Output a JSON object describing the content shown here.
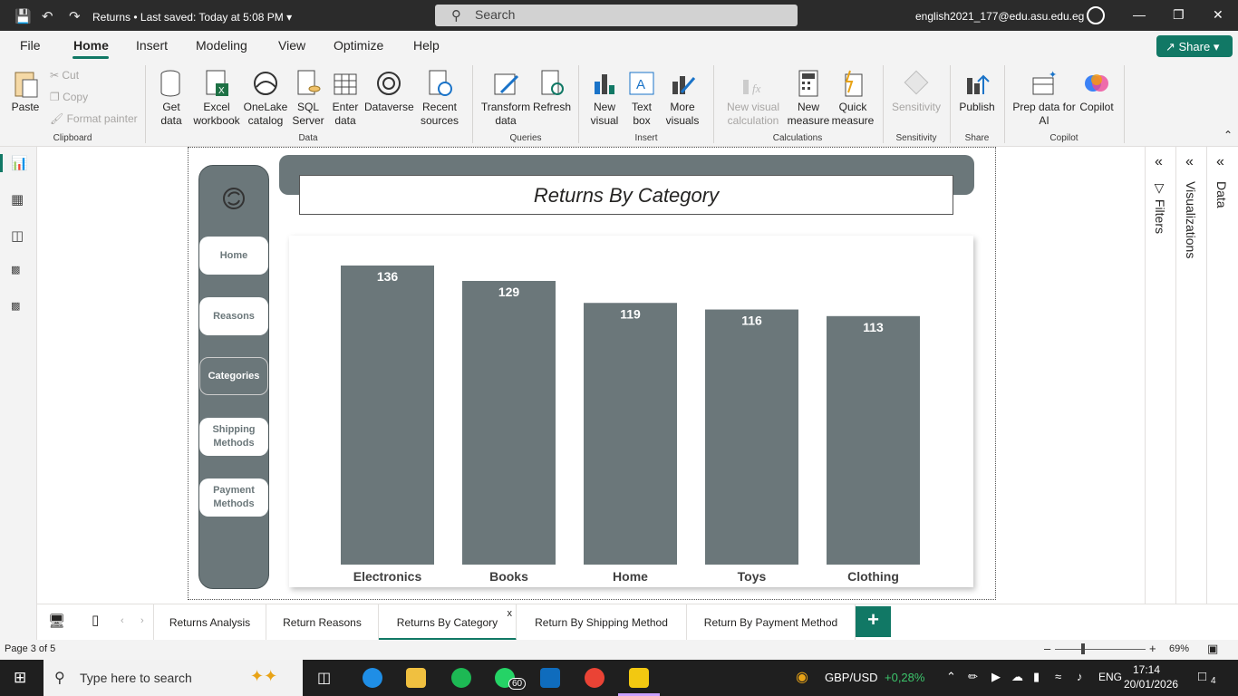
{
  "titlebar": {
    "doc_title": "Returns",
    "saved_status": "Last saved: Today at 5:08 PM",
    "search_placeholder": "Search",
    "account": "english2021_177@edu.asu.edu.eg"
  },
  "menu": {
    "items": [
      "File",
      "Home",
      "Insert",
      "Modeling",
      "View",
      "Optimize",
      "Help"
    ],
    "active": "Home",
    "share_label": "Share"
  },
  "ribbon": {
    "clipboard": {
      "paste": "Paste",
      "cut": "Cut",
      "copy": "Copy",
      "format_painter": "Format painter",
      "group": "Clipboard"
    },
    "data": {
      "get_data": "Get data",
      "excel": "Excel workbook",
      "onelake": "OneLake catalog",
      "sql": "SQL Server",
      "enter": "Enter data",
      "dataverse": "Dataverse",
      "recent": "Recent sources",
      "group": "Data"
    },
    "queries": {
      "transform": "Transform data",
      "refresh": "Refresh",
      "group": "Queries"
    },
    "insert": {
      "new_visual": "New visual",
      "text_box": "Text box",
      "more_visuals": "More visuals",
      "group": "Insert"
    },
    "calculations": {
      "new_visual_calc": "New visual calculation",
      "new_measure": "New measure",
      "quick_measure": "Quick measure",
      "group": "Calculations"
    },
    "sensitivity": {
      "label": "Sensitivity",
      "group": "Sensitivity"
    },
    "share": {
      "publish": "Publish",
      "group": "Share"
    },
    "copilot": {
      "prep": "Prep data for AI",
      "copilot": "Copilot",
      "group": "Copilot"
    }
  },
  "report": {
    "nav_buttons": [
      "Home",
      "Reasons",
      "Categories",
      "Shipping Methods",
      "Payment Methods"
    ],
    "selected_nav": "Categories",
    "page_title": "Returns By Category"
  },
  "chart_data": {
    "type": "bar",
    "categories": [
      "Electronics",
      "Books",
      "Home",
      "Toys",
      "Clothing"
    ],
    "values": [
      136,
      129,
      119,
      116,
      113
    ],
    "title": "Returns By Category",
    "ylim": [
      0,
      136
    ],
    "bar_color": "#6b777a",
    "grid": false,
    "data_labels": true
  },
  "panes": {
    "filters": "Filters",
    "visualizations": "Visualizations",
    "data": "Data"
  },
  "tabs": {
    "items": [
      "Returns Analysis",
      "Return Reasons",
      "Returns By Category",
      "Return By Shipping Method",
      "Return By Payment Method"
    ],
    "active": "Returns By Category",
    "close_glyph": "x"
  },
  "status": {
    "page": "Page 3 of 5",
    "zoom": "69%"
  },
  "taskbar": {
    "search_placeholder": "Type here to search",
    "whatsapp_badge": "60",
    "currency": "GBP/USD",
    "currency_change": "+0,28%",
    "language": "ENG",
    "time": "17:14",
    "date": "20/01/2026",
    "notifications": "4"
  },
  "colors": {
    "accent": "#117865",
    "bar": "#6b777a",
    "titlebar": "#2b2b2b"
  }
}
